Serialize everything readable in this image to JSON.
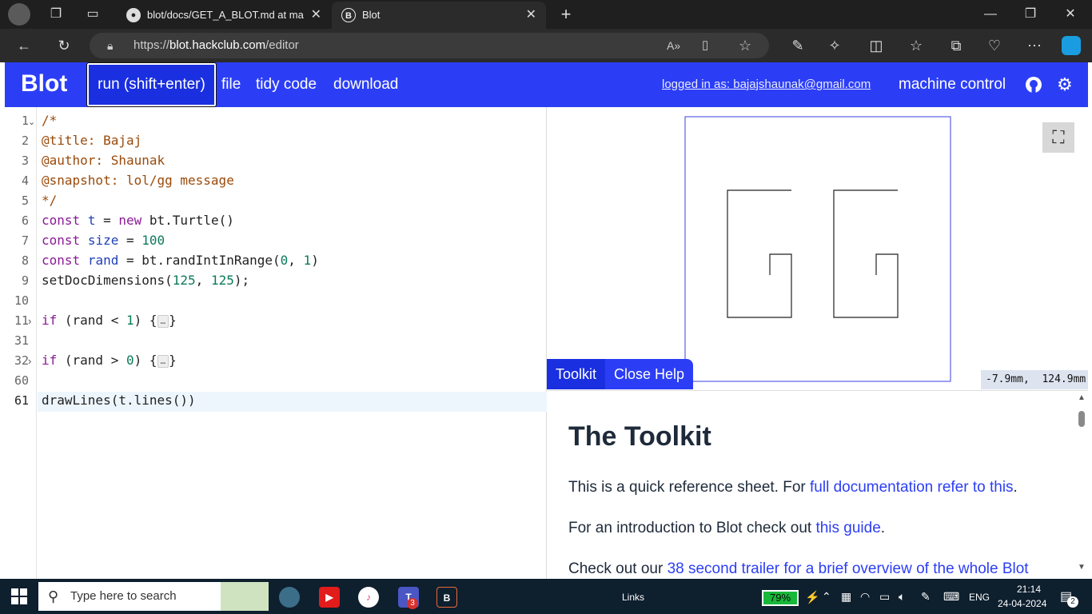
{
  "browser": {
    "tabs": [
      {
        "title": "blot/docs/GET_A_BLOT.md at ma",
        "icon": "github-icon"
      },
      {
        "title": "Blot",
        "icon": "blot-icon"
      }
    ],
    "url_prefix": "https://",
    "url_host": "blot.hackclub.com",
    "url_path": "/editor"
  },
  "app": {
    "logo": "Blot",
    "menu": {
      "run": "run (shift+enter)",
      "file": "file",
      "tidy": "tidy code",
      "download": "download"
    },
    "login": "logged in as: bajajshaunak@gmail.com",
    "machine_control": "machine control"
  },
  "editor": {
    "lines": [
      {
        "n": "1",
        "fold": "open"
      },
      {
        "n": "2"
      },
      {
        "n": "3"
      },
      {
        "n": "4"
      },
      {
        "n": "5"
      },
      {
        "n": "6"
      },
      {
        "n": "7"
      },
      {
        "n": "8"
      },
      {
        "n": "9"
      },
      {
        "n": "10"
      },
      {
        "n": "11",
        "fold": "closed"
      },
      {
        "n": "31"
      },
      {
        "n": "32",
        "fold": "closed"
      },
      {
        "n": "60"
      },
      {
        "n": "61"
      }
    ],
    "code": {
      "l1": "/*",
      "l2": "@title: Bajaj",
      "l3": "@author: Shaunak",
      "l4": "@snapshot: lol/gg message",
      "l5": "*/",
      "l6_kw": "const",
      "l6_var": "t",
      "l6_eq": " = ",
      "l6_new": "new",
      "l6_rest": " bt.Turtle()",
      "l7_kw": "const",
      "l7_var": "size",
      "l7_eq": " = ",
      "l7_num": "100",
      "l8_kw": "const",
      "l8_var": "rand",
      "l8_mid": " = bt.randIntInRange(",
      "l8_n1": "0",
      "l8_sep": ", ",
      "l8_n2": "1",
      "l8_end": ")",
      "l9_fn": "setDocDimensions(",
      "l9_n1": "125",
      "l9_sep": ", ",
      "l9_n2": "125",
      "l9_end": ");",
      "l11_kw": "if",
      "l11_mid": " (rand < ",
      "l11_num": "1",
      "l11_end": ") {",
      "l32_kw": "if",
      "l32_mid": " (rand > ",
      "l32_num": "0",
      "l32_end": ") {",
      "fold_marker": "…",
      "close_brace": "}",
      "l61": "drawLines(t.lines())"
    }
  },
  "preview": {
    "coords": "-7.9mm,  124.9mm"
  },
  "help": {
    "tabs": {
      "toolkit": "Toolkit",
      "close": "Close Help"
    },
    "heading": "The Toolkit",
    "p1_text": "This is a quick reference sheet. For ",
    "p1_link": "full documentation refer to this",
    "p1_end": ".",
    "p2_text": "For an introduction to Blot check out ",
    "p2_link": "this guide",
    "p2_end": ".",
    "p3_text": "Check out our ",
    "p3_link": "38 second trailer for a brief overview of the whole Blot"
  },
  "taskbar": {
    "search_placeholder": "Type here to search",
    "links_label": "Links",
    "battery": "79%",
    "lang": "ENG",
    "time": "21:14",
    "date": "24-04-2024",
    "notif_count": "2",
    "teams_badge": "3"
  },
  "colors": {
    "brand_blue": "#2c3ef5",
    "battery_green": "#18b83a"
  }
}
